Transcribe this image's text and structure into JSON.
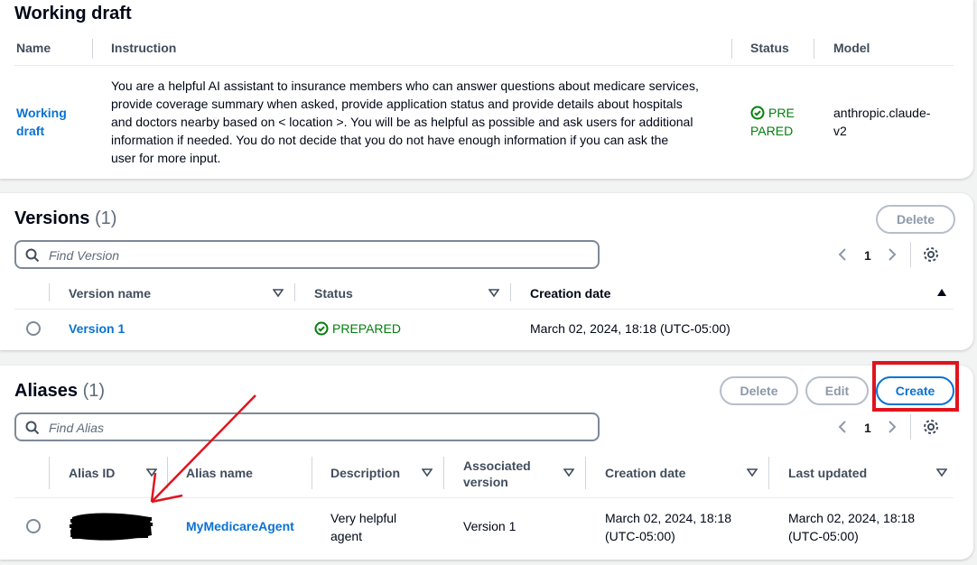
{
  "working_draft": {
    "title": "Working draft",
    "headers": {
      "name": "Name",
      "instruction": "Instruction",
      "status": "Status",
      "model": "Model"
    },
    "row": {
      "name_line1": "Working",
      "name_line2": "draft",
      "instruction_lines": [
        "You are a helpful AI assistant to insurance members who can answer questions about medicare services,",
        "provide coverage summary when asked, provide application status and provide details about hospitals",
        "and doctors nearby based on < location >. You will be as helpful as possible and ask users for additional",
        "information if needed. You do not decide that you do not have enough information if you can ask the",
        "user for more input."
      ],
      "status_line1": "PRE",
      "status_line2": "PARED",
      "model_line1": "anthropic.claude-",
      "model_line2": "v2"
    }
  },
  "versions": {
    "title": "Versions",
    "count": "(1)",
    "delete_label": "Delete",
    "search_placeholder": "Find Version",
    "page": "1",
    "headers": {
      "version_name": "Version name",
      "status": "Status",
      "creation_date": "Creation date"
    },
    "rows": [
      {
        "name": "Version 1",
        "status": "PREPARED",
        "creation_date": "March 02, 2024, 18:18 (UTC-05:00)"
      }
    ]
  },
  "aliases": {
    "title": "Aliases",
    "count": "(1)",
    "delete_label": "Delete",
    "edit_label": "Edit",
    "create_label": "Create",
    "search_placeholder": "Find Alias",
    "page": "1",
    "headers": {
      "alias_id": "Alias ID",
      "alias_name": "Alias name",
      "description": "Description",
      "associated_version_line1": "Associated",
      "associated_version_line2": "version",
      "creation_date": "Creation date",
      "last_updated": "Last updated"
    },
    "rows": [
      {
        "alias_name": "MyMedicareAgent",
        "description_line1": "Very helpful",
        "description_line2": "agent",
        "associated_version": "Version 1",
        "creation_date_line1": "March 02, 2024, 18:18",
        "creation_date_line2": "(UTC-05:00)",
        "last_updated_line1": "March 02, 2024, 18:18",
        "last_updated_line2": "(UTC-05:00)"
      }
    ]
  },
  "colors": {
    "link": "#0972d3",
    "success": "#037f0c",
    "annotation_red": "#e0141e"
  }
}
